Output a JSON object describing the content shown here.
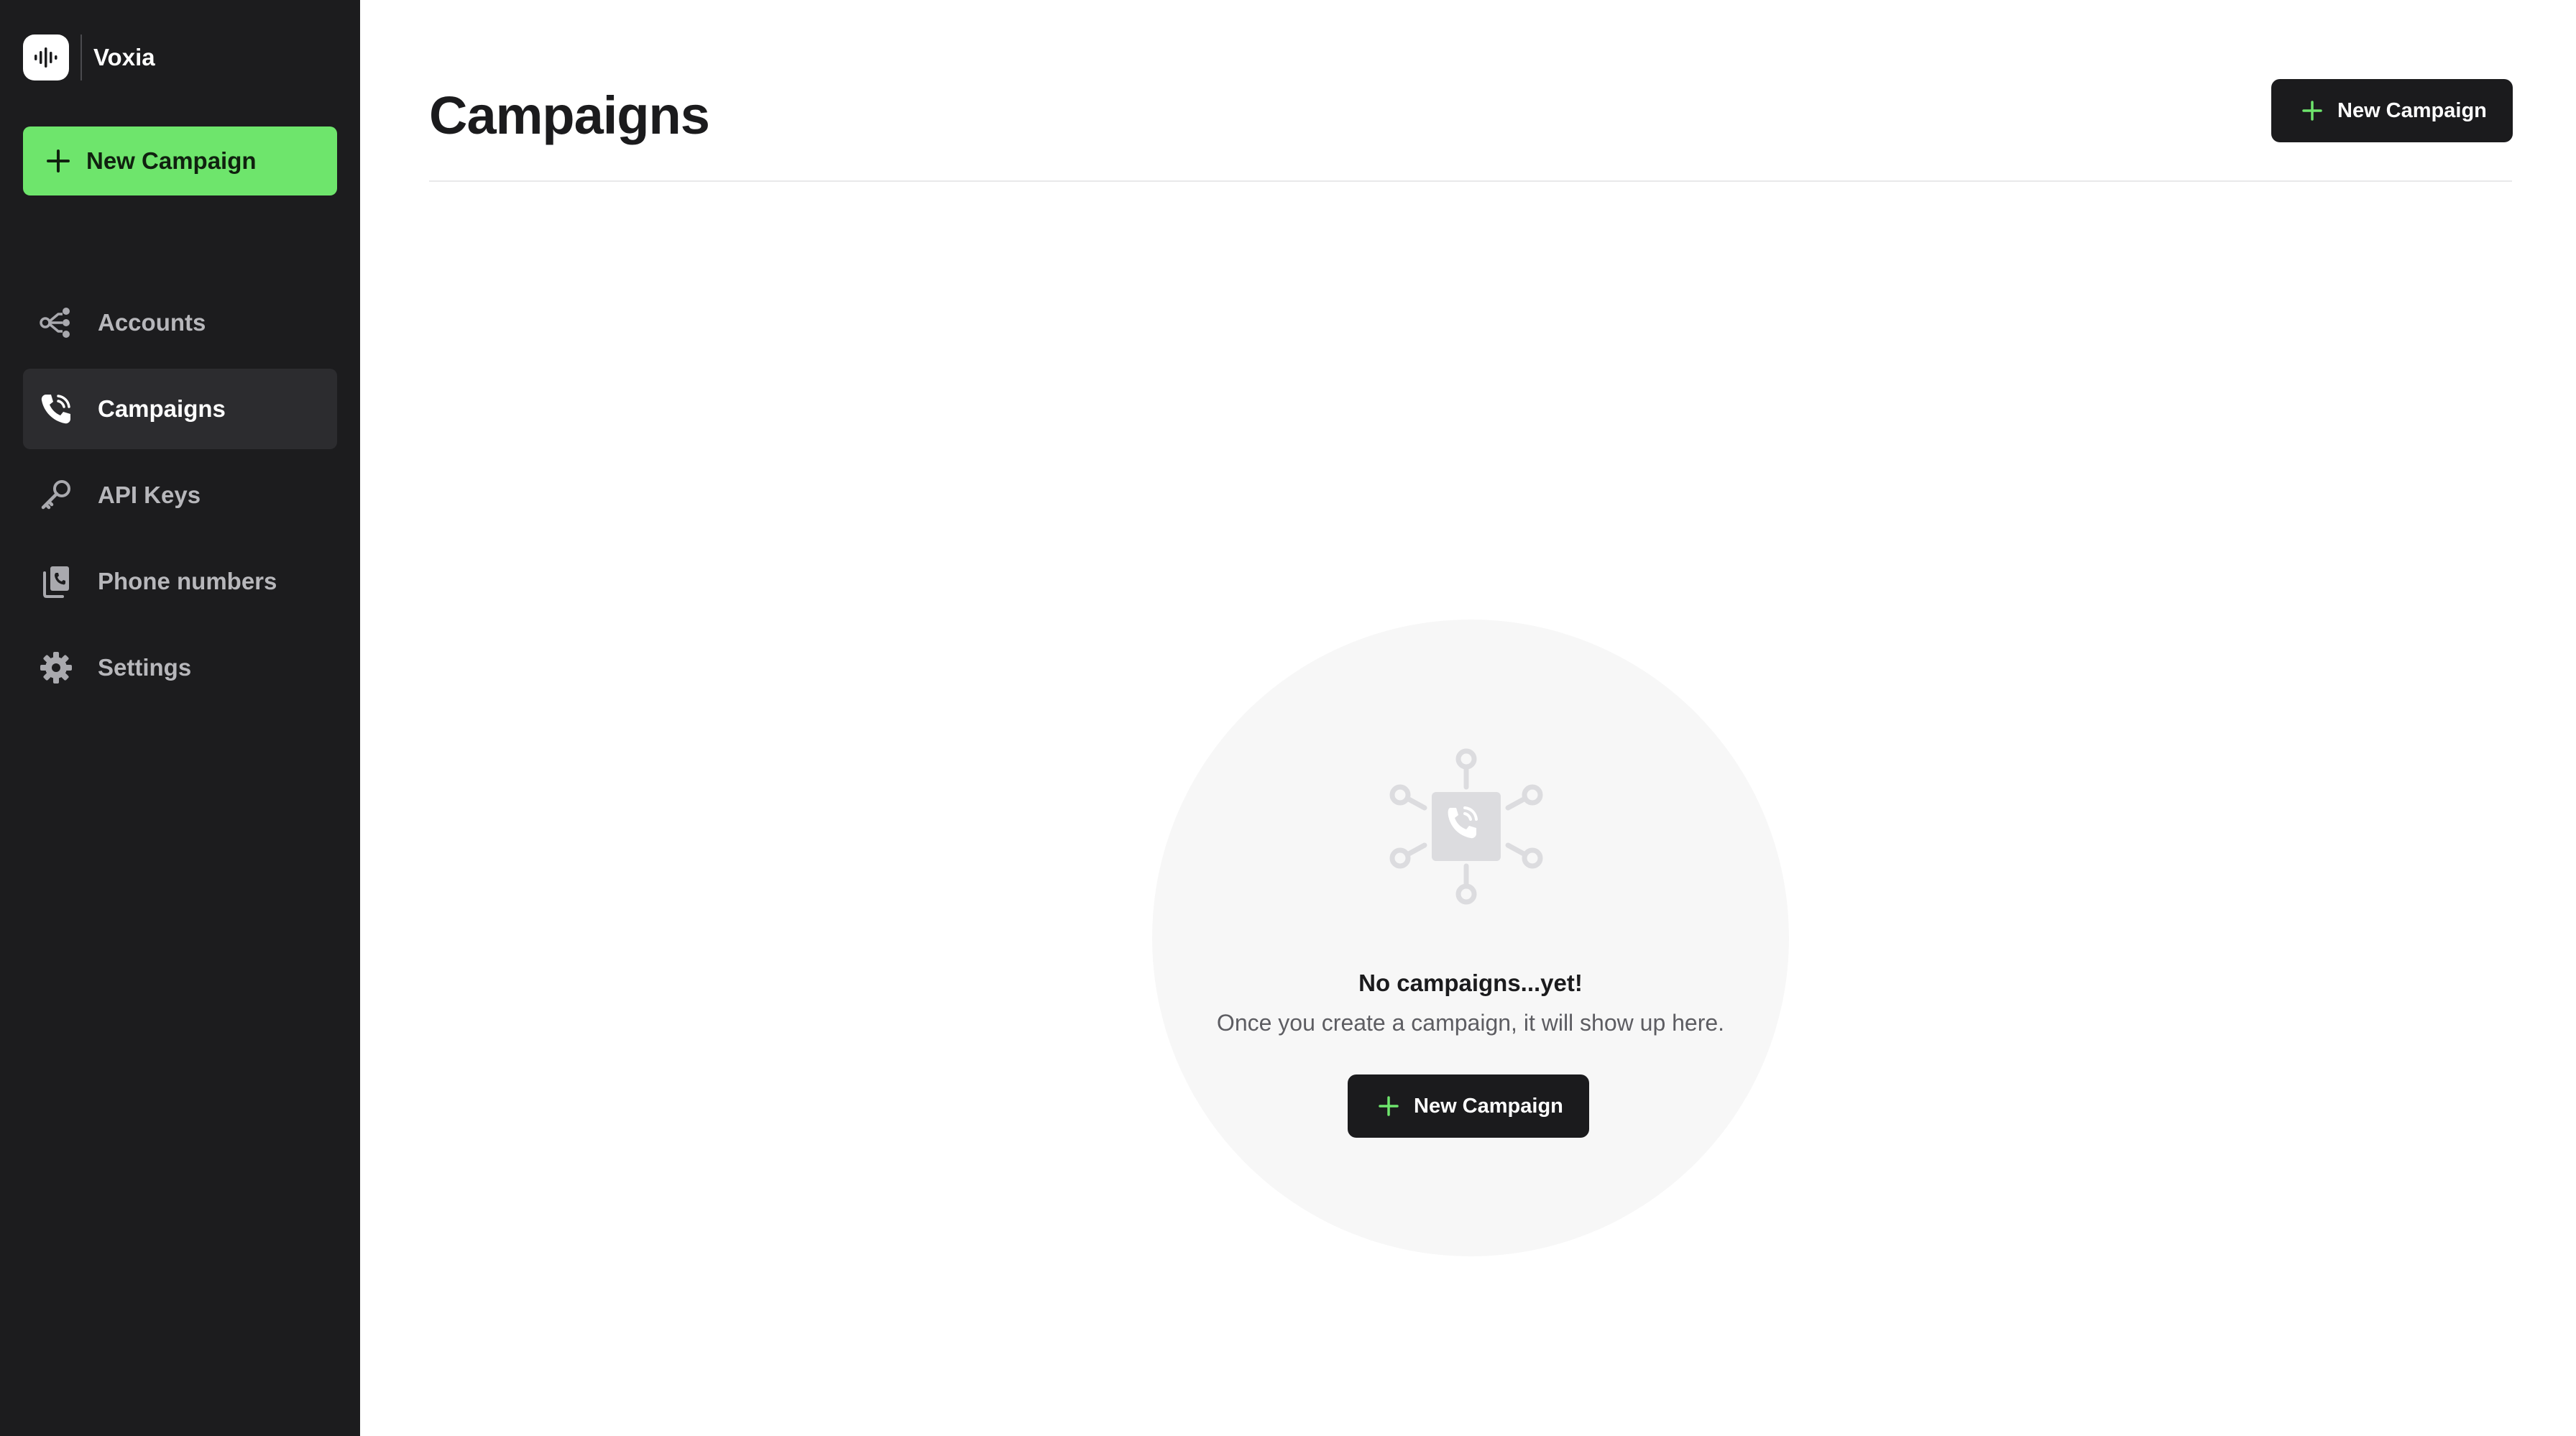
{
  "brand": {
    "name": "Voxia",
    "logo_icon": "soundwave-icon"
  },
  "sidebar": {
    "new_button_label": "New Campaign",
    "items": [
      {
        "label": "Accounts",
        "icon": "accounts-hierarchy-icon",
        "active": false
      },
      {
        "label": "Campaigns",
        "icon": "phone-call-icon",
        "active": true
      },
      {
        "label": "API Keys",
        "icon": "key-icon",
        "active": false
      },
      {
        "label": "Phone numbers",
        "icon": "phone-numbers-icon",
        "active": false
      },
      {
        "label": "Settings",
        "icon": "gear-icon",
        "active": false
      }
    ]
  },
  "header": {
    "title": "Campaigns",
    "new_button_label": "New Campaign"
  },
  "empty_state": {
    "icon": "campaign-network-icon",
    "title": "No campaigns...yet!",
    "subtitle": "Once you create a campaign, it will show up here.",
    "button_label": "New Campaign"
  },
  "colors": {
    "sidebar_bg": "#1c1c1e",
    "accent_green": "#6ee56c",
    "primary_dark": "#1b1b1d"
  }
}
